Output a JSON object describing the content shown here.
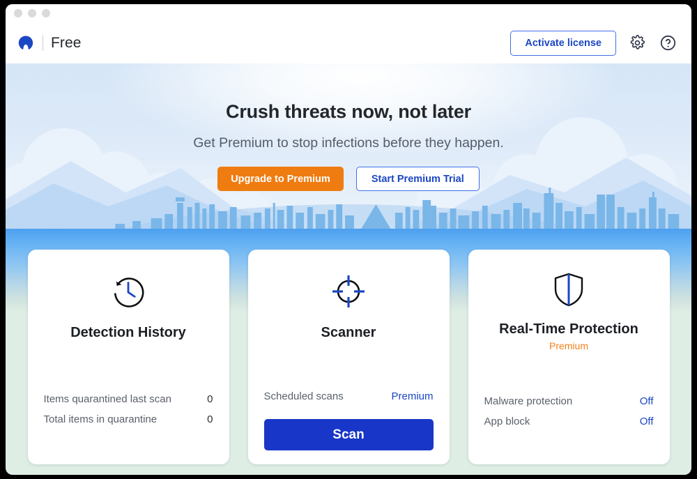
{
  "window": {
    "traffic_lights": [
      "close",
      "minimize",
      "zoom"
    ]
  },
  "header": {
    "brand_logo_icon": "malwarebytes-logo-icon",
    "brand_name": "Free",
    "activate_label": "Activate license",
    "settings_icon": "gear-icon",
    "help_icon": "question-mark-icon"
  },
  "hero": {
    "title": "Crush threats now, not later",
    "subtitle": "Get Premium to stop infections before they happen.",
    "upgrade_label": "Upgrade to Premium",
    "trial_label": "Start Premium Trial"
  },
  "cards": [
    {
      "id": "detection-history",
      "icon": "clock-history-icon",
      "title": "Detection History",
      "badge": null,
      "rows": [
        {
          "label": "Items quarantined last scan",
          "value": "0",
          "is_link": false
        },
        {
          "label": "Total items in quarantine",
          "value": "0",
          "is_link": false
        }
      ],
      "button": null
    },
    {
      "id": "scanner",
      "icon": "crosshair-target-icon",
      "title": "Scanner",
      "badge": null,
      "rows": [
        {
          "label": "Scheduled scans",
          "value": "Premium",
          "is_link": true
        }
      ],
      "button": "Scan"
    },
    {
      "id": "real-time-protection",
      "icon": "shield-icon",
      "title": "Real-Time Protection",
      "badge": "Premium",
      "rows": [
        {
          "label": "Malware protection",
          "value": "Off",
          "is_link": true
        },
        {
          "label": "App block",
          "value": "Off",
          "is_link": true
        }
      ],
      "button": null
    }
  ],
  "colors": {
    "brand_blue": "#1836c7",
    "link_blue": "#1c47c4",
    "accent_orange": "#ef7c10",
    "premium_orange": "#f08019",
    "app_background": "#dfeee4",
    "band_blue": "#4da0ef"
  }
}
